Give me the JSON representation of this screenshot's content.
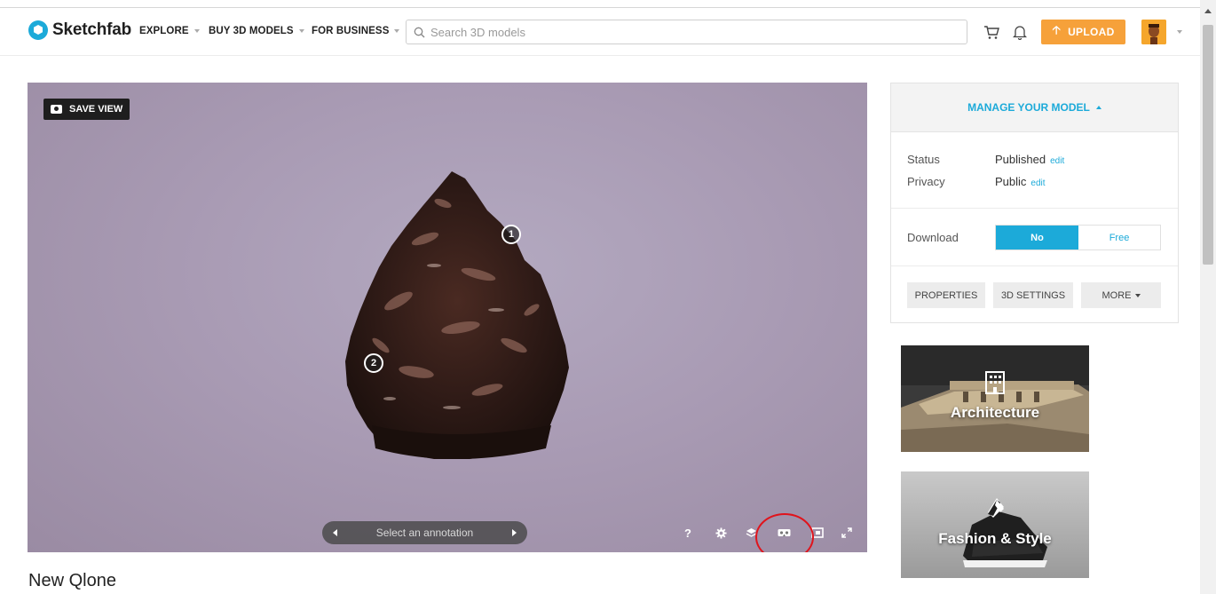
{
  "header": {
    "logo_text": "Sketchfab",
    "nav": [
      {
        "label": "EXPLORE"
      },
      {
        "label": "BUY 3D MODELS"
      },
      {
        "label": "FOR BUSINESS"
      }
    ],
    "search_placeholder": "Search 3D models",
    "upload_label": "UPLOAD",
    "colors": {
      "accent": "#1caad9",
      "upload": "#f6a13a"
    }
  },
  "viewer": {
    "save_view_label": "SAVE VIEW",
    "hotspots": [
      "1",
      "2"
    ],
    "annotation_placeholder": "Select an annotation",
    "help_label": "?"
  },
  "model": {
    "title": "New Qlone"
  },
  "panel": {
    "manage_label": "MANAGE YOUR MODEL",
    "status_label": "Status",
    "status_value": "Published",
    "privacy_label": "Privacy",
    "privacy_value": "Public",
    "edit_label": "edit",
    "download_label": "Download",
    "download_options": [
      "No",
      "Free"
    ],
    "buttons": [
      "PROPERTIES",
      "3D SETTINGS",
      "MORE"
    ]
  },
  "categories": [
    {
      "label": "Architecture"
    },
    {
      "label": "Fashion & Style"
    }
  ]
}
